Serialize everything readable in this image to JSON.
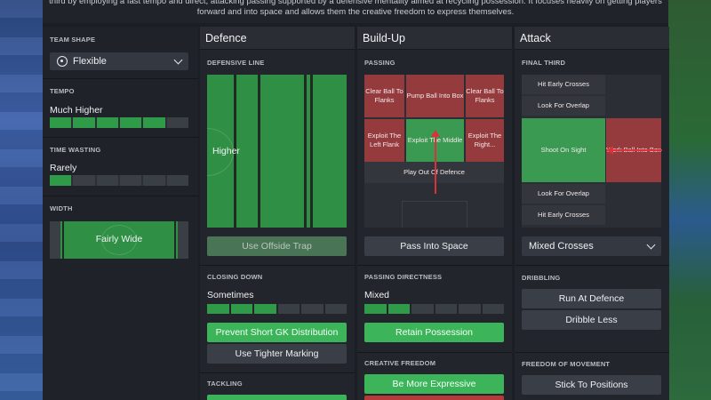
{
  "description": "third by employing a fast tempo and direct, attacking passing supported by a defensive mentality aimed at recycling possession. It focuses heavily on getting players forward and into space and allows them the creative freedom to express themselves.",
  "sidebar": {
    "team_shape_label": "TEAM SHAPE",
    "team_shape_value": "Flexible",
    "tempo_label": "TEMPO",
    "tempo_value": "Much Higher",
    "tempo_level": 5,
    "tempo_max": 6,
    "time_wasting_label": "TIME WASTING",
    "time_wasting_value": "Rarely",
    "time_wasting_level": 1,
    "time_wasting_max": 6,
    "width_label": "WIDTH",
    "width_value": "Fairly Wide"
  },
  "defence": {
    "title": "Defence",
    "defensive_line_label": "DEFENSIVE LINE",
    "defensive_line_value": "Higher",
    "offside_trap_label": "Use Offside Trap",
    "closing_down_label": "CLOSING DOWN",
    "closing_down_value": "Sometimes",
    "closing_down_level": 3,
    "closing_down_max": 6,
    "prevent_gk_label": "Prevent Short GK Distribution",
    "tighter_marking_label": "Use Tighter Marking",
    "tackling_label": "TACKLING"
  },
  "buildup": {
    "title": "Build-Up",
    "passing_label": "PASSING",
    "cells": {
      "clear_left": "Clear Ball To Flanks",
      "pump": "Pump Ball Into Box",
      "clear_right": "Clear Ball To Flanks",
      "exploit_left": "Exploit The Left Flank",
      "exploit_middle": "Exploit The Middle",
      "exploit_right": "Exploit The Right...",
      "play_out": "Play Out Of Defence"
    },
    "pass_into_space_label": "Pass Into Space",
    "passing_directness_label": "PASSING DIRECTNESS",
    "passing_directness_value": "Mixed",
    "passing_directness_level": 2,
    "passing_directness_max": 6,
    "retain_possession_label": "Retain Possession",
    "creative_freedom_label": "CREATIVE FREEDOM",
    "be_more_expressive_label": "Be More Expressive"
  },
  "attack": {
    "title": "Attack",
    "final_third_label": "FINAL THIRD",
    "hit_early_top": "Hit Early Crosses",
    "look_overlap_top": "Look For Overlap",
    "shoot_on_sight": "Shoot On Sight",
    "work_ball_into_box": "Work Ball Into Box",
    "look_overlap_bottom": "Look For Overlap",
    "hit_early_bottom": "Hit Early Crosses",
    "crosses_value": "Mixed Crosses",
    "dribbling_label": "DRIBBLING",
    "run_at_defence_label": "Run At Defence",
    "dribble_less_label": "Dribble Less",
    "freedom_label": "FREEDOM OF MOVEMENT",
    "stick_to_positions_label": "Stick To Positions"
  },
  "colors": {
    "accent_green": "#3cb55a",
    "selected_red": "#953a3d",
    "panel_bg": "#22252b"
  }
}
